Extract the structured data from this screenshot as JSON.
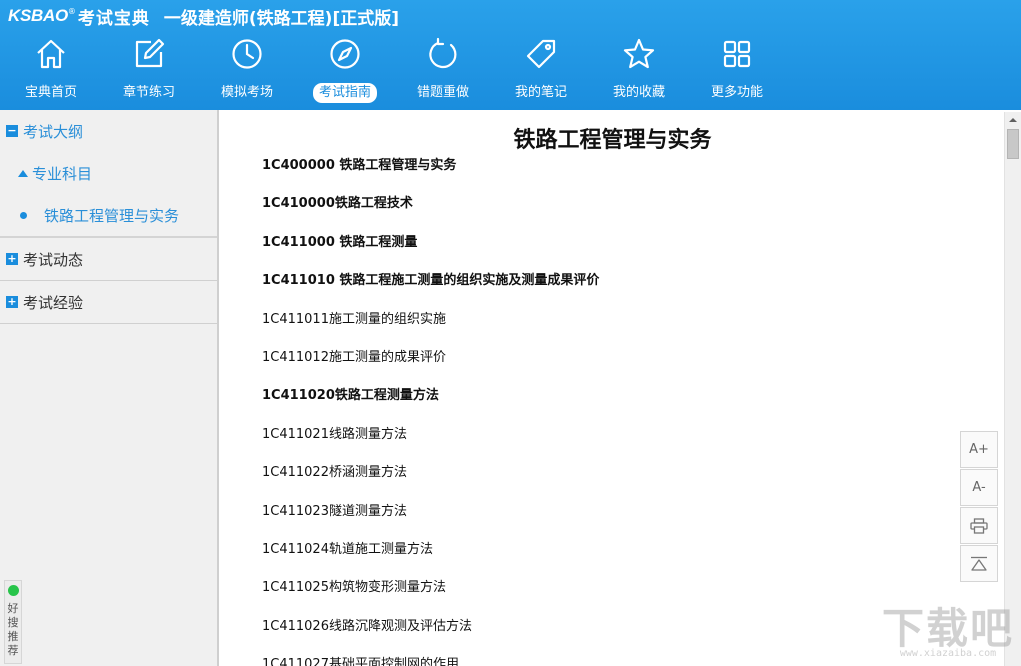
{
  "app": {
    "logo_latin": "KSBAO",
    "logo_reg": "®",
    "logo_cn": "考试宝典",
    "title": "一级建造师(铁路工程)[正式版]"
  },
  "nav": {
    "items": [
      {
        "label": "宝典首页",
        "icon": "home-icon"
      },
      {
        "label": "章节练习",
        "icon": "edit-icon"
      },
      {
        "label": "模拟考场",
        "icon": "clock-icon"
      },
      {
        "label": "考试指南",
        "icon": "compass-icon",
        "active": true
      },
      {
        "label": "错题重做",
        "icon": "refresh-icon"
      },
      {
        "label": "我的笔记",
        "icon": "tag-icon"
      },
      {
        "label": "我的收藏",
        "icon": "star-icon"
      },
      {
        "label": "更多功能",
        "icon": "grid-icon"
      }
    ]
  },
  "sidebar": {
    "groups": [
      {
        "toggle": "−",
        "label": "考试大纲"
      },
      {
        "toggle": "+",
        "label": "考试动态"
      },
      {
        "toggle": "+",
        "label": "考试经验"
      }
    ],
    "sub_label": "专业科目",
    "leaf_label": "铁路工程管理与实务",
    "widget_text": "好搜推荐"
  },
  "document": {
    "title": "铁路工程管理与实务",
    "lines": [
      {
        "text": "1C400000  铁路工程管理与实务",
        "bold": true
      },
      {
        "text": "1C410000铁路工程技术",
        "bold": true
      },
      {
        "text": "1C411000  铁路工程测量",
        "bold": true
      },
      {
        "text": "1C411010  铁路工程施工测量的组织实施及测量成果评价",
        "bold": true
      },
      {
        "text": "1C411011施工测量的组织实施",
        "bold": false
      },
      {
        "text": "1C411012施工测量的成果评价",
        "bold": false
      },
      {
        "text": "1C411020铁路工程测量方法",
        "bold": true
      },
      {
        "text": "1C411021线路测量方法",
        "bold": false
      },
      {
        "text": "1C411022桥涵测量方法",
        "bold": false
      },
      {
        "text": "1C411023隧道测量方法",
        "bold": false
      },
      {
        "text": "1C411024轨道施工测量方法",
        "bold": false
      },
      {
        "text": "1C411025构筑物变形测量方法",
        "bold": false
      },
      {
        "text": "1C411026线路沉降观测及评估方法",
        "bold": false
      },
      {
        "text": "1C411027基础平面控制网的作用",
        "bold": false
      }
    ]
  },
  "tools": {
    "font_increase": "A+",
    "font_decrease": "A-",
    "print_icon": "print-icon",
    "top_icon": "back-to-top-icon"
  },
  "watermark": {
    "big": "下载吧",
    "small": "www.xiazaiba.com"
  },
  "colors": {
    "brand_blue": "#1a8ddd",
    "link_blue": "#2a8fd8",
    "sidebar_bg": "#f0f0f0"
  }
}
